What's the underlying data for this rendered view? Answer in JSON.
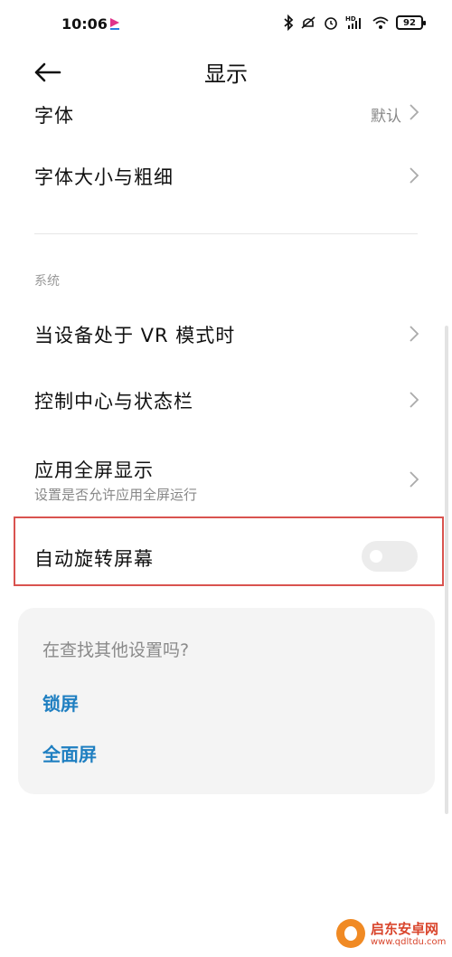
{
  "status_bar": {
    "time": "10:06",
    "battery": "92",
    "icons": [
      "bluetooth-icon",
      "mute-icon",
      "alarm-icon",
      "hd-signal-icon",
      "wifi-icon",
      "battery-icon"
    ]
  },
  "header": {
    "title": "显示",
    "back_icon": "back-arrow-icon"
  },
  "rows": {
    "font": {
      "title": "字体",
      "value": "默认"
    },
    "font_size": {
      "title": "字体大小与粗细"
    },
    "section_system": "系统",
    "vr_mode": {
      "title": "当设备处于 VR 模式时"
    },
    "control_center": {
      "title": "控制中心与状态栏"
    },
    "fullscreen": {
      "title": "应用全屏显示",
      "subtitle": "设置是否允许应用全屏运行"
    },
    "auto_rotate": {
      "title": "自动旋转屏幕",
      "enabled": false
    }
  },
  "suggest": {
    "title": "在查找其他设置吗?",
    "links": [
      "锁屏",
      "全面屏"
    ]
  },
  "watermark": {
    "name": "启东安卓网",
    "url": "www.qdltdu.com"
  },
  "colors": {
    "link": "#1f7fc1",
    "highlight_border": "#d9534f",
    "toggle_off": "#ececec"
  }
}
